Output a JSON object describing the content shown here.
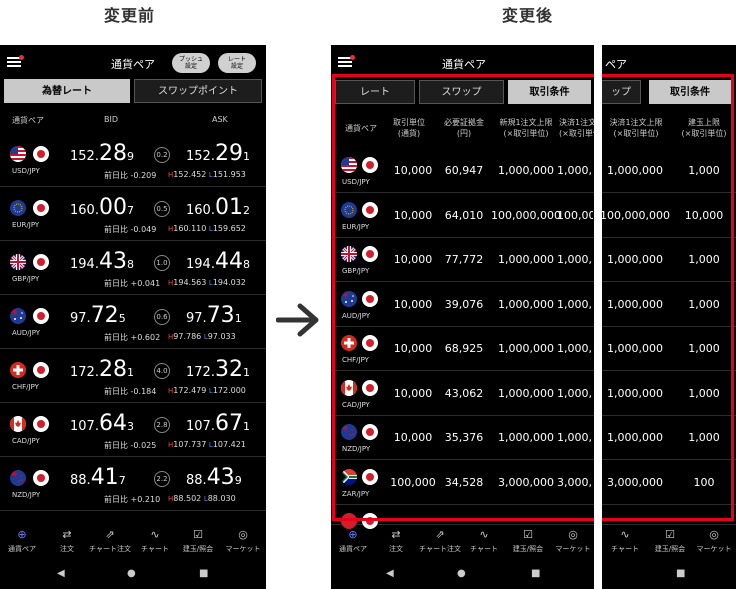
{
  "headings": {
    "before": "変更前",
    "after": "変更後"
  },
  "colors": {
    "accent_red": "#e6001e",
    "high": "#e05050",
    "low": "#4a8ae0"
  },
  "before": {
    "title": "通貨ペア",
    "push_button": "プッシュ\n設定",
    "rate_button": "レート\n設定",
    "tabs": [
      "為替レート",
      "スワップポイント"
    ],
    "headers": {
      "pair": "通貨ペア",
      "bid": "BID",
      "ask": "ASK"
    },
    "rows": [
      {
        "pair": "USD/JPY",
        "flag": "us",
        "bid_a": "152.",
        "bid_b": "28",
        "bid_c": "9",
        "spread": "0.2",
        "ask_a": "152.",
        "ask_b": "29",
        "ask_c": "1",
        "change_label": "前日比",
        "change": "-0.209",
        "high": "152.452",
        "low": "151.953"
      },
      {
        "pair": "EUR/JPY",
        "flag": "eu",
        "bid_a": "160.",
        "bid_b": "00",
        "bid_c": "7",
        "spread": "0.5",
        "ask_a": "160.",
        "ask_b": "01",
        "ask_c": "2",
        "change_label": "前日比",
        "change": "-0.049",
        "high": "160.110",
        "low": "159.652"
      },
      {
        "pair": "GBP/JPY",
        "flag": "gb",
        "bid_a": "194.",
        "bid_b": "43",
        "bid_c": "8",
        "spread": "1.0",
        "ask_a": "194.",
        "ask_b": "44",
        "ask_c": "8",
        "change_label": "前日比",
        "change": "+0.041",
        "high": "194.563",
        "low": "194.032"
      },
      {
        "pair": "AUD/JPY",
        "flag": "au",
        "bid_a": "97.",
        "bid_b": "72",
        "bid_c": "5",
        "spread": "0.6",
        "ask_a": "97.",
        "ask_b": "73",
        "ask_c": "1",
        "change_label": "前日比",
        "change": "+0.602",
        "high": "97.786",
        "low": "97.033"
      },
      {
        "pair": "CHF/JPY",
        "flag": "ch",
        "bid_a": "172.",
        "bid_b": "28",
        "bid_c": "1",
        "spread": "4.0",
        "ask_a": "172.",
        "ask_b": "32",
        "ask_c": "1",
        "change_label": "前日比",
        "change": "-0.184",
        "high": "172.479",
        "low": "172.000"
      },
      {
        "pair": "CAD/JPY",
        "flag": "ca",
        "bid_a": "107.",
        "bid_b": "64",
        "bid_c": "3",
        "spread": "2.8",
        "ask_a": "107.",
        "ask_b": "67",
        "ask_c": "1",
        "change_label": "前日比",
        "change": "-0.025",
        "high": "107.737",
        "low": "107.421"
      },
      {
        "pair": "NZD/JPY",
        "flag": "nz",
        "bid_a": "88.",
        "bid_b": "41",
        "bid_c": "7",
        "spread": "2.2",
        "ask_a": "88.",
        "ask_b": "43",
        "ask_c": "9",
        "change_label": "前日比",
        "change": "+0.210",
        "high": "88.502",
        "low": "88.030"
      }
    ]
  },
  "nav": [
    "通貨ペア",
    "注文",
    "チャート注文",
    "チャート",
    "建玉/照会",
    "マーケット"
  ],
  "after": {
    "title": "通貨ペア",
    "title_right": "ペア",
    "tabs": [
      "レート",
      "スワップ",
      "取引条件"
    ],
    "tab_right": [
      "ップ",
      "取引条件"
    ],
    "col_pair": "通貨ペア",
    "col_headers": [
      "取引単位\n(通貨)",
      "必要証拠金\n(円)",
      "新規1注文上限\n(×取引単位)",
      "決済1注文上\n(×取引単位)"
    ],
    "right_headers": [
      "決済1注文上限\n(×取引単位)",
      "建玉上限\n(×取引単位)"
    ],
    "rows": [
      {
        "pair": "USD/JPY",
        "flag": "us",
        "unit": "10,000",
        "margin": "60,947",
        "new_limit": "1,000,000",
        "close_limit_cut": "1,000,(",
        "close_limit": "1,000,000",
        "position_limit": "1,000"
      },
      {
        "pair": "EUR/JPY",
        "flag": "eu",
        "unit": "10,000",
        "margin": "64,010",
        "new_limit": "100,000,000",
        "close_limit_cut": "100,000",
        "close_limit": "100,000,000",
        "position_limit": "10,000"
      },
      {
        "pair": "GBP/JPY",
        "flag": "gb",
        "unit": "10,000",
        "margin": "77,772",
        "new_limit": "1,000,000",
        "close_limit_cut": "1,000,(",
        "close_limit": "1,000,000",
        "position_limit": "1,000"
      },
      {
        "pair": "AUD/JPY",
        "flag": "au",
        "unit": "10,000",
        "margin": "39,076",
        "new_limit": "1,000,000",
        "close_limit_cut": "1,000,(",
        "close_limit": "1,000,000",
        "position_limit": "1,000"
      },
      {
        "pair": "CHF/JPY",
        "flag": "ch",
        "unit": "10,000",
        "margin": "68,925",
        "new_limit": "1,000,000",
        "close_limit_cut": "1,000,(",
        "close_limit": "1,000,000",
        "position_limit": "1,000"
      },
      {
        "pair": "CAD/JPY",
        "flag": "ca",
        "unit": "10,000",
        "margin": "43,062",
        "new_limit": "1,000,000",
        "close_limit_cut": "1,000,(",
        "close_limit": "1,000,000",
        "position_limit": "1,000"
      },
      {
        "pair": "NZD/JPY",
        "flag": "nz",
        "unit": "10,000",
        "margin": "35,376",
        "new_limit": "1,000,000",
        "close_limit_cut": "1,000,(",
        "close_limit": "1,000,000",
        "position_limit": "1,000"
      },
      {
        "pair": "ZAR/JPY",
        "flag": "za",
        "unit": "100,000",
        "margin": "34,528",
        "new_limit": "3,000,000",
        "close_limit_cut": "3,000,(",
        "close_limit": "3,000,000",
        "position_limit": "100"
      }
    ],
    "right_nav": [
      "チャート",
      "建玉/照会",
      "マーケット"
    ]
  }
}
